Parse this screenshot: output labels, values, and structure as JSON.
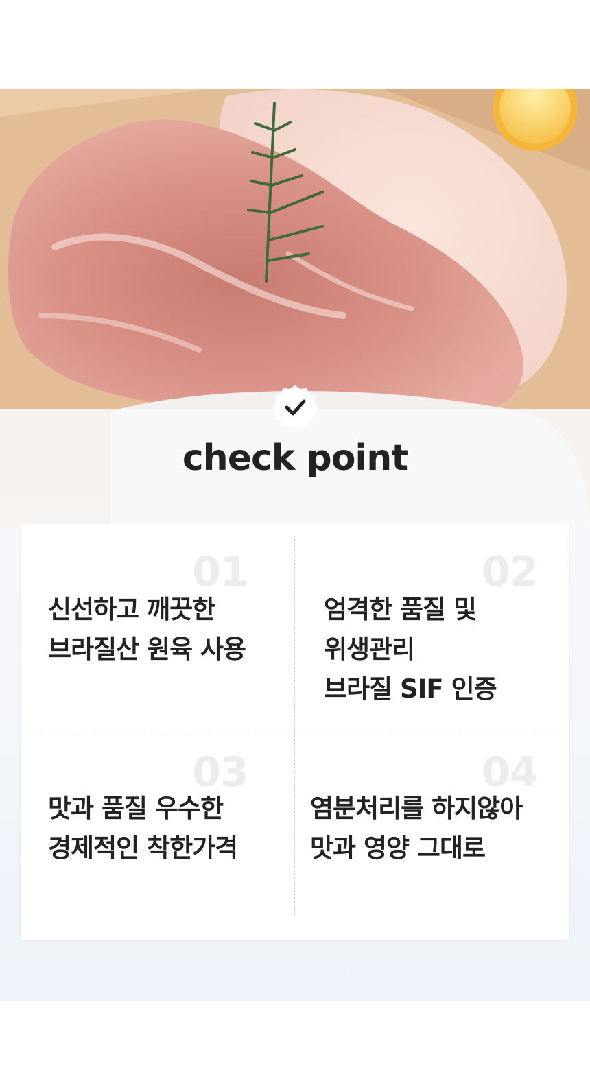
{
  "hero": {
    "image_icon": "raw-chicken-thigh-photo",
    "headline": "check point",
    "badge_icon": "check-icon"
  },
  "colors": {
    "headline": "#222222",
    "number": "#ececec",
    "text": "#222222",
    "card_bg": "#ffffff",
    "panel_bg": "#eef3f9"
  },
  "points": [
    {
      "number": "01",
      "text": "신선하고 깨끗한\n브라질산 원육 사용"
    },
    {
      "number": "02",
      "text": "엄격한 품질 및\n위생관리\n브라질 SIF 인증"
    },
    {
      "number": "03",
      "text": "맛과 품질 우수한\n경제적인 착한가격"
    },
    {
      "number": "04",
      "text": "염분처리를 하지않아\n맛과 영양 그대로"
    }
  ]
}
